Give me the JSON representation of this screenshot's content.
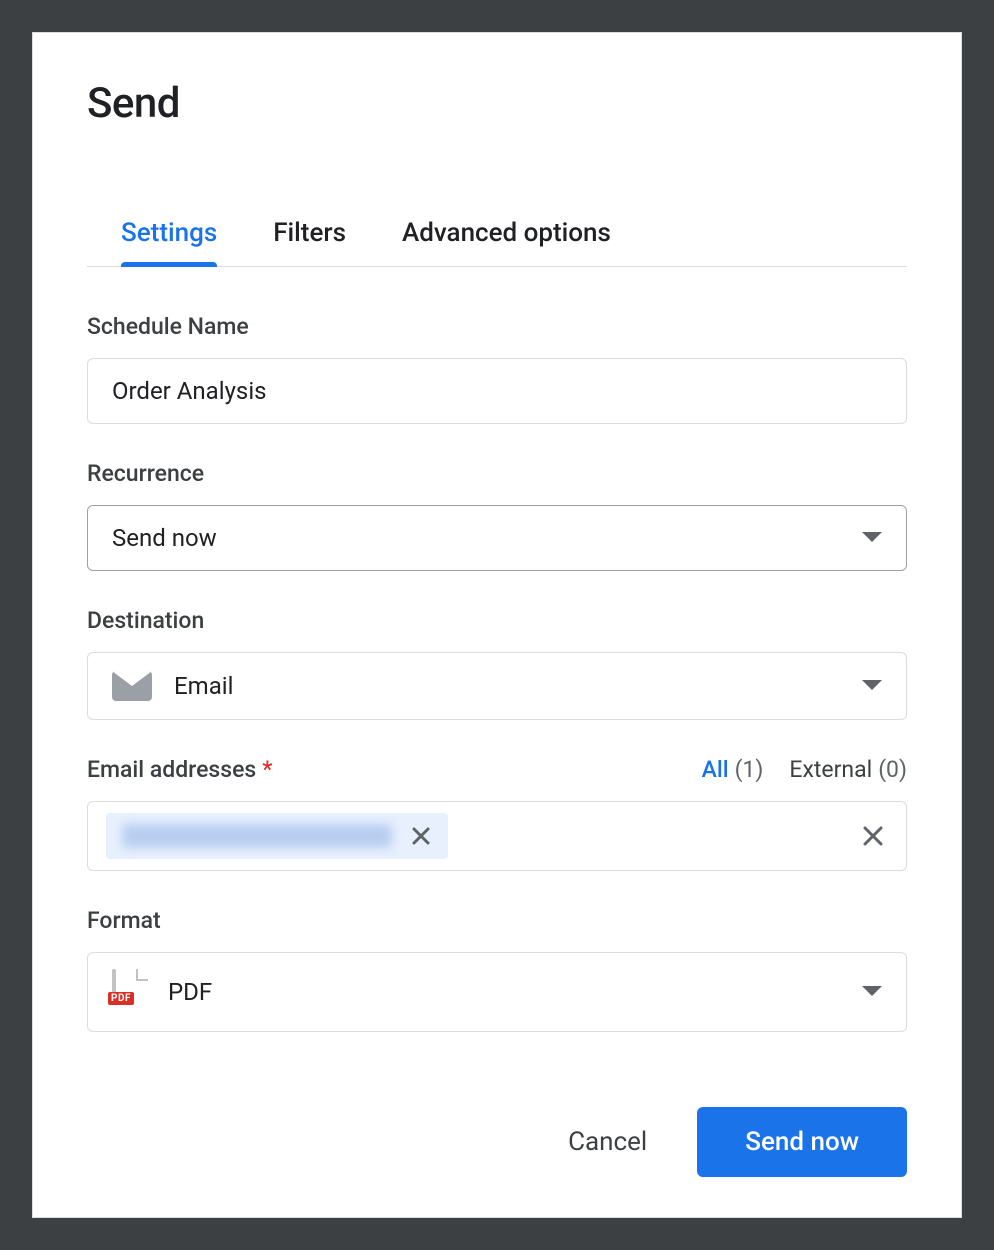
{
  "dialog": {
    "title": "Send"
  },
  "tabs": {
    "settings": "Settings",
    "filters": "Filters",
    "advanced": "Advanced options"
  },
  "fields": {
    "schedule_name": {
      "label": "Schedule Name",
      "value": "Order Analysis"
    },
    "recurrence": {
      "label": "Recurrence",
      "value": "Send now"
    },
    "destination": {
      "label": "Destination",
      "value": "Email",
      "icon": "email-icon"
    },
    "email_addresses": {
      "label": "Email addresses",
      "required_marker": "*",
      "counters": {
        "all": {
          "label": "All",
          "count": "(1)"
        },
        "external": {
          "label": "External",
          "count": "(0)"
        }
      },
      "chips": [
        {
          "text_redacted": true
        }
      ]
    },
    "format": {
      "label": "Format",
      "value": "PDF",
      "icon": "pdf-icon",
      "icon_badge": "PDF"
    }
  },
  "actions": {
    "cancel": "Cancel",
    "submit": "Send now"
  }
}
